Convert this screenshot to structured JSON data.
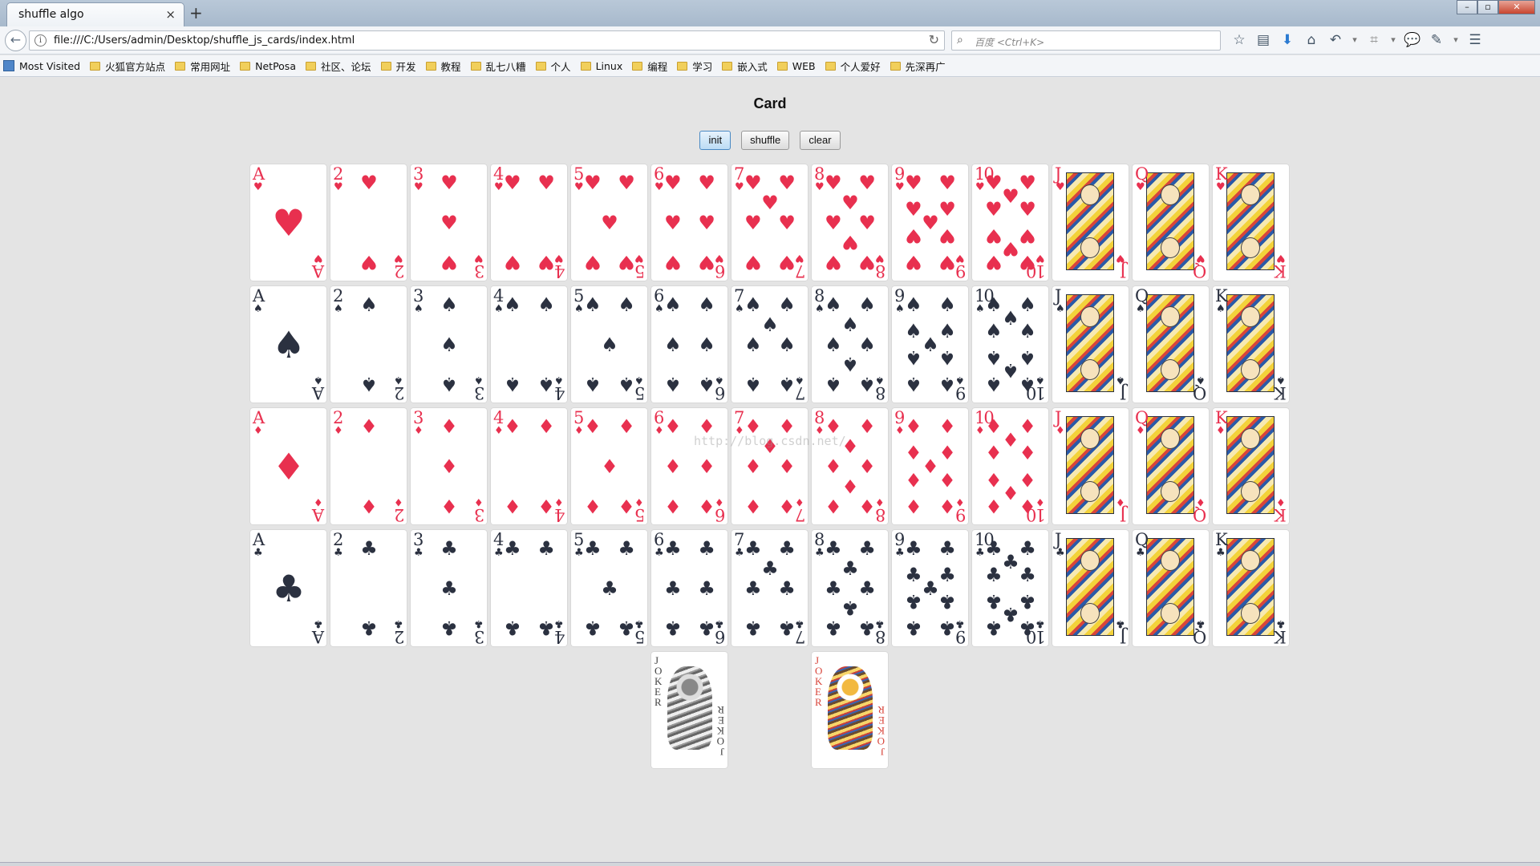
{
  "browser": {
    "tab_title": "shuffle algo",
    "tab_close": "×",
    "new_tab": "+",
    "url": "file:///C:/Users/admin/Desktop/shuffle_js_cards/index.html",
    "search_placeholder": "百度 <Ctrl+K>",
    "window_controls": [
      "–",
      "▫",
      "✕"
    ],
    "toolbar_icons": [
      "star-icon",
      "reader-icon",
      "download-icon",
      "home-icon",
      "undo-icon",
      "dropdown-icon",
      "crop-icon",
      "dropdown-icon",
      "chat-icon",
      "plugin-icon",
      "dropdown-icon",
      "menu-icon"
    ]
  },
  "bookmarks": [
    {
      "label": "Most Visited",
      "type": "special"
    },
    {
      "label": "火狐官方站点",
      "type": "folder"
    },
    {
      "label": "常用网址",
      "type": "folder"
    },
    {
      "label": "NetPosa",
      "type": "folder"
    },
    {
      "label": "社区、论坛",
      "type": "folder"
    },
    {
      "label": "开发",
      "type": "folder"
    },
    {
      "label": "教程",
      "type": "folder"
    },
    {
      "label": "乱七八糟",
      "type": "folder"
    },
    {
      "label": "个人",
      "type": "folder"
    },
    {
      "label": "Linux",
      "type": "folder"
    },
    {
      "label": "编程",
      "type": "folder"
    },
    {
      "label": "学习",
      "type": "folder"
    },
    {
      "label": "嵌入式",
      "type": "folder"
    },
    {
      "label": "WEB",
      "type": "folder"
    },
    {
      "label": "个人爱好",
      "type": "folder"
    },
    {
      "label": "先深再广",
      "type": "folder"
    }
  ],
  "page": {
    "title": "Card",
    "buttons": {
      "init": "init",
      "shuffle": "shuffle",
      "clear": "clear"
    },
    "active_button": "init",
    "watermark": "http://blog.csdn.net/"
  },
  "colors": {
    "red_suit": "#e8304f",
    "black_suit": "#2b3140",
    "background": "#e4e4e4"
  },
  "cards": {
    "suits": [
      {
        "name": "hearts",
        "symbol": "♥",
        "color": "red"
      },
      {
        "name": "spades",
        "symbol": "♠",
        "color": "black"
      },
      {
        "name": "diamonds",
        "symbol": "♦",
        "color": "red"
      },
      {
        "name": "clubs",
        "symbol": "♣",
        "color": "black"
      }
    ],
    "ranks": [
      "A",
      "2",
      "3",
      "4",
      "5",
      "6",
      "7",
      "8",
      "9",
      "10",
      "J",
      "Q",
      "K"
    ],
    "jokers": [
      {
        "label": "JOKER",
        "variant": "black"
      },
      {
        "label": "JOKER",
        "variant": "color"
      }
    ]
  }
}
